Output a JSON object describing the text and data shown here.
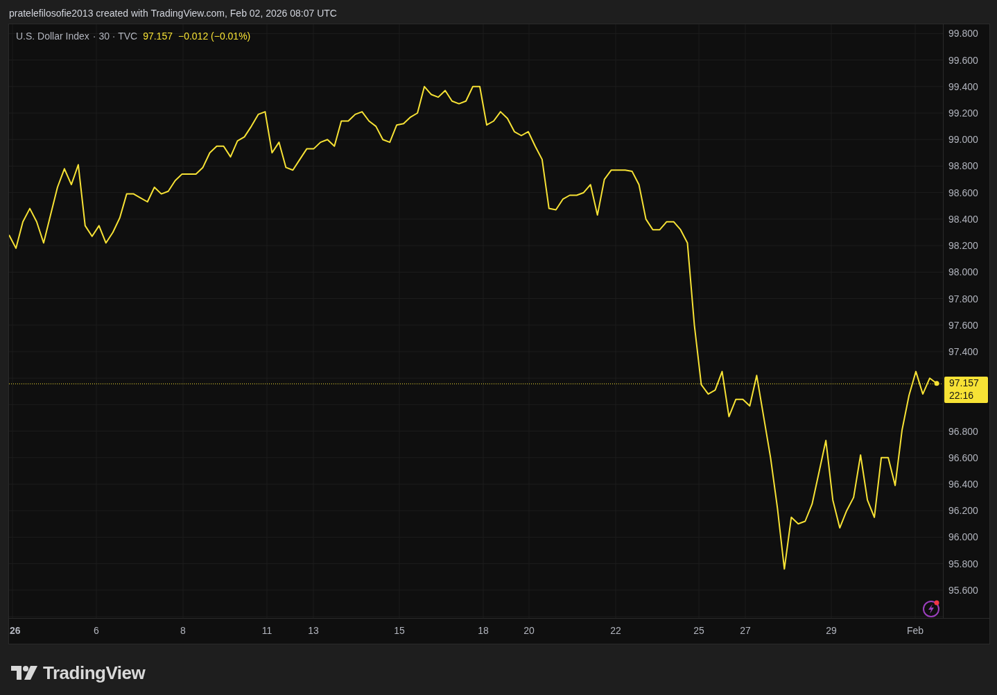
{
  "header": {
    "credit": "pratelefilosofie2013 created with TradingView.com, Feb 02, 2026 08:07 UTC"
  },
  "legend": {
    "details": "· 30 · TVC",
    "price": "97.157",
    "change": "−0.012 (−0.01%)"
  },
  "price_label": {
    "price": "97.157",
    "countdown": "22:16"
  },
  "chart_data": {
    "type": "line",
    "categories": [
      null,
      null,
      null,
      null,
      null,
      null,
      null,
      null,
      null,
      null,
      null,
      null,
      null,
      null,
      null,
      null,
      null,
      null,
      null,
      null,
      null,
      null,
      null,
      null,
      null,
      null,
      null,
      null,
      null,
      null,
      null,
      null,
      null,
      null,
      null,
      null,
      null,
      null,
      null,
      null,
      null,
      null,
      null,
      null,
      null,
      null,
      null,
      null,
      null,
      null,
      null,
      null,
      null,
      null,
      null,
      null,
      null,
      null,
      null,
      null,
      null,
      null,
      null,
      null,
      null,
      null,
      null,
      null,
      null,
      null,
      null,
      null,
      null,
      null,
      null,
      null,
      null,
      null,
      null,
      null,
      null,
      null,
      null,
      null,
      null,
      null,
      null,
      null,
      null,
      null,
      null,
      null,
      null,
      null,
      null,
      null,
      null,
      null,
      null,
      null,
      null,
      null,
      null,
      null,
      null,
      null,
      null,
      null,
      null,
      null,
      null,
      null,
      null,
      null,
      null,
      null,
      null,
      null,
      null,
      null,
      null,
      null,
      null,
      null,
      null,
      null,
      null,
      null,
      null,
      null,
      null,
      null,
      null,
      null,
      null
    ],
    "series": [
      {
        "name": "U.S. Dollar Index",
        "color": "#f7e235",
        "values": [
          98.28,
          98.18,
          98.38,
          98.48,
          98.38,
          98.22,
          98.43,
          98.64,
          98.78,
          98.66,
          98.81,
          98.35,
          98.27,
          98.35,
          98.22,
          98.3,
          98.41,
          98.59,
          98.59,
          98.56,
          98.53,
          98.64,
          98.59,
          98.61,
          98.69,
          98.74,
          98.74,
          98.74,
          98.79,
          98.9,
          98.95,
          98.95,
          98.87,
          98.99,
          99.02,
          99.1,
          99.19,
          99.21,
          98.9,
          98.98,
          98.79,
          98.77,
          98.85,
          98.93,
          98.93,
          98.98,
          99.0,
          98.95,
          99.14,
          99.14,
          99.19,
          99.21,
          99.14,
          99.1,
          99.0,
          98.98,
          99.11,
          99.12,
          99.17,
          99.2,
          99.4,
          99.34,
          99.32,
          99.37,
          99.29,
          99.27,
          99.29,
          99.4,
          99.4,
          99.11,
          99.14,
          99.21,
          99.16,
          99.06,
          99.03,
          99.06,
          98.95,
          98.85,
          98.48,
          98.47,
          98.55,
          98.58,
          98.58,
          98.6,
          98.66,
          98.43,
          98.7,
          98.77,
          98.77,
          98.77,
          98.76,
          98.66,
          98.4,
          98.32,
          98.32,
          98.38,
          98.38,
          98.32,
          98.22,
          97.6,
          97.15,
          97.08,
          97.11,
          97.25,
          96.91,
          97.04,
          97.04,
          96.99,
          97.22,
          96.91,
          96.6,
          96.22,
          95.76,
          96.15,
          96.1,
          96.12,
          96.25,
          96.49,
          96.73,
          96.28,
          96.07,
          96.2,
          96.3,
          96.62,
          96.28,
          96.15,
          96.6,
          96.6,
          96.39,
          96.81,
          97.07,
          97.25,
          97.08,
          97.2,
          97.16
        ]
      }
    ],
    "ylim": [
      95.39,
      99.87
    ],
    "grid": true,
    "ref_lines": [
      {
        "axis": "y",
        "value": 97.157,
        "color": "#f7e235"
      }
    ],
    "yticks": [
      {
        "value": 99.8,
        "label": "99.800"
      },
      {
        "value": 99.6,
        "label": "99.600"
      },
      {
        "value": 99.4,
        "label": "99.400"
      },
      {
        "value": 99.2,
        "label": "99.200"
      },
      {
        "value": 99.0,
        "label": "99.000"
      },
      {
        "value": 98.8,
        "label": "98.800"
      },
      {
        "value": 98.6,
        "label": "98.600"
      },
      {
        "value": 98.4,
        "label": "98.400"
      },
      {
        "value": 98.2,
        "label": "98.200"
      },
      {
        "value": 98.0,
        "label": "98.000"
      },
      {
        "value": 97.8,
        "label": "97.800"
      },
      {
        "value": 97.6,
        "label": "97.600"
      },
      {
        "value": 97.4,
        "label": "97.400"
      },
      {
        "value": 96.8,
        "label": "96.800"
      },
      {
        "value": 96.6,
        "label": "96.600"
      },
      {
        "value": 96.4,
        "label": "96.400"
      },
      {
        "value": 96.2,
        "label": "96.200"
      },
      {
        "value": 96.0,
        "label": "96.000"
      },
      {
        "value": 95.8,
        "label": "95.800"
      },
      {
        "value": 95.6,
        "label": "95.600"
      }
    ]
  },
  "time_axis": {
    "labels": [
      "26",
      "6",
      "8",
      "11",
      "13",
      "15",
      "18",
      "20",
      "22",
      "25",
      "27",
      "29",
      "Feb"
    ]
  },
  "logo": {
    "text": "TradingView"
  }
}
